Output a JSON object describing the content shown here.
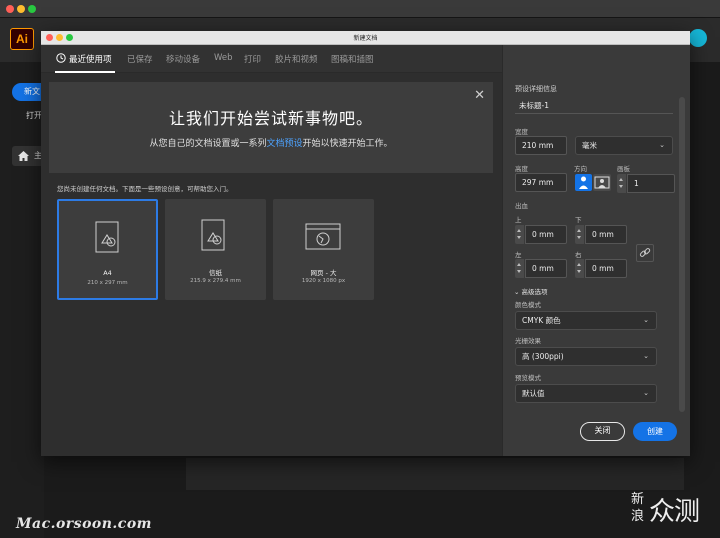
{
  "app": {
    "logo_text": "Ai",
    "sidebar_new": "新文",
    "sidebar_open": "打开",
    "sidebar_home": "主"
  },
  "dialog": {
    "title": "新建文档",
    "tabs": [
      {
        "label": "最近使用项",
        "active": true
      },
      {
        "label": "已保存",
        "active": false
      },
      {
        "label": "移动设备",
        "active": false
      },
      {
        "label": "Web",
        "active": false
      },
      {
        "label": "打印",
        "active": false
      },
      {
        "label": "胶片和视频",
        "active": false
      },
      {
        "label": "图稿和插图",
        "active": false
      }
    ],
    "banner": {
      "title": "让我们开始尝试新事物吧。",
      "subtitle_pre": "从您自己的文档设置或一系列",
      "subtitle_link": "文档预设",
      "subtitle_post": "开始以快速开始工作。"
    },
    "hint": "您尚未创建任何文档。下面是一些预设创意，可帮助您入门。",
    "presets": [
      {
        "name": "A4",
        "size": "210 x 297 mm",
        "selected": true,
        "icon": "document-icon"
      },
      {
        "name": "信纸",
        "size": "215.9 x 279.4 mm",
        "selected": false,
        "icon": "document-icon"
      },
      {
        "name": "网页 - 大",
        "size": "1920 x 1080 px",
        "selected": false,
        "icon": "web-page-icon"
      }
    ],
    "details": {
      "section_title": "预设详细信息",
      "doc_name": "未标题-1",
      "width_label": "宽度",
      "width_value": "210 mm",
      "unit_value": "毫米",
      "height_label": "高度",
      "height_value": "297 mm",
      "orientation_label": "方向",
      "artboards_label": "画板",
      "artboards_value": "1",
      "bleed_label": "出血",
      "top_label": "上",
      "top_value": "0 mm",
      "bottom_label": "下",
      "bottom_value": "0 mm",
      "left_label": "左",
      "left_value": "0 mm",
      "right_label": "右",
      "right_value": "0 mm",
      "advanced_label": "高级选项",
      "color_mode_label": "颜色模式",
      "color_mode_value": "CMYK 颜色",
      "raster_label": "光栅效果",
      "raster_value": "高 (300ppi)",
      "preview_label": "预览模式",
      "preview_value": "默认值"
    },
    "buttons": {
      "close": "关闭",
      "create": "创建"
    }
  },
  "watermarks": {
    "left": "Mac.orsoon.com",
    "right_top": "新",
    "right_bottom": "浪",
    "right_main": "众测"
  },
  "colors": {
    "accent": "#1473e6",
    "link": "#4da3ff",
    "ai_orange": "#ff9a00"
  }
}
